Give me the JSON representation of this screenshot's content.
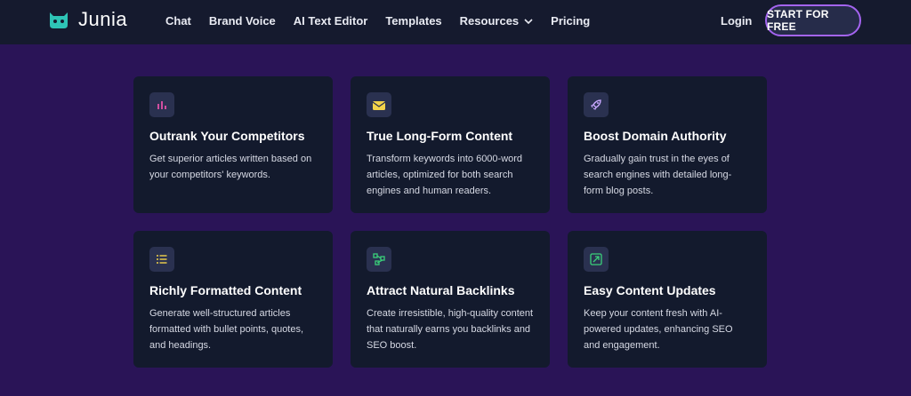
{
  "header": {
    "brand": "Junia",
    "menu": [
      {
        "label": "Chat"
      },
      {
        "label": "Brand Voice"
      },
      {
        "label": "AI Text Editor"
      },
      {
        "label": "Templates"
      },
      {
        "label": "Resources"
      },
      {
        "label": "Pricing"
      }
    ],
    "login_label": "Login",
    "cta_label": "START FOR FREE"
  },
  "features": [
    {
      "icon": "bar-chart-icon",
      "title": "Outrank Your Competitors",
      "desc": "Get superior articles written based on your competitors' keywords."
    },
    {
      "icon": "envelope-icon",
      "title": "True Long-Form Content",
      "desc": "Transform keywords into 6000-word articles, optimized for both search engines and human readers."
    },
    {
      "icon": "rocket-icon",
      "title": "Boost Domain Authority",
      "desc": "Gradually gain trust in the eyes of search engines with detailed long-form blog posts."
    },
    {
      "icon": "list-icon",
      "title": "Richly Formatted Content",
      "desc": "Generate well-structured articles formatted with bullet points, quotes, and headings."
    },
    {
      "icon": "network-icon",
      "title": "Attract Natural Backlinks",
      "desc": "Create irresistible, high-quality content that naturally earns you backlinks and SEO boost."
    },
    {
      "icon": "update-icon",
      "title": "Easy Content Updates",
      "desc": "Keep your content fresh with AI-powered updates, enhancing SEO and engagement."
    }
  ],
  "colors": {
    "page_bg": "#2a1457",
    "nav_bg": "#151a2e",
    "card_bg": "#131a2d",
    "cta_border": "#a464f0",
    "brand_teal": "#2ec4b6"
  }
}
